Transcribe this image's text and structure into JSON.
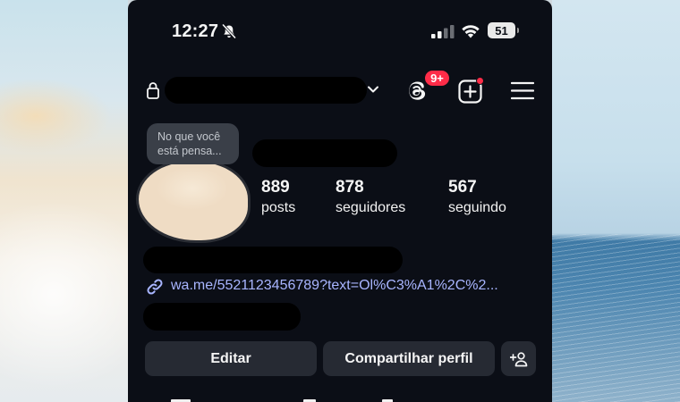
{
  "status_bar": {
    "time": "12:27",
    "battery": "51",
    "icons": [
      "bell-slash-icon",
      "cellular-signal-icon",
      "wifi-icon",
      "battery-icon"
    ]
  },
  "header": {
    "notification_badge": "9+",
    "icons": [
      "lock-icon",
      "chevron-down-icon",
      "threads-icon",
      "create-post-icon",
      "menu-icon"
    ]
  },
  "profile": {
    "note_line1": "No que você",
    "note_line2": "está pensa...",
    "stats": [
      {
        "value": "889",
        "label": "posts"
      },
      {
        "value": "878",
        "label": "seguidores"
      },
      {
        "value": "567",
        "label": "seguindo"
      }
    ],
    "link": "wa.me/5521123456789?text=Ol%C3%A1%2C%2..."
  },
  "actions": {
    "edit": "Editar",
    "share": "Compartilhar perfil"
  },
  "colors": {
    "phone_bg": "#0b0e16",
    "button_bg": "#262a33",
    "badge_red": "#ff2c48",
    "link_blue": "#a8b5ff"
  }
}
